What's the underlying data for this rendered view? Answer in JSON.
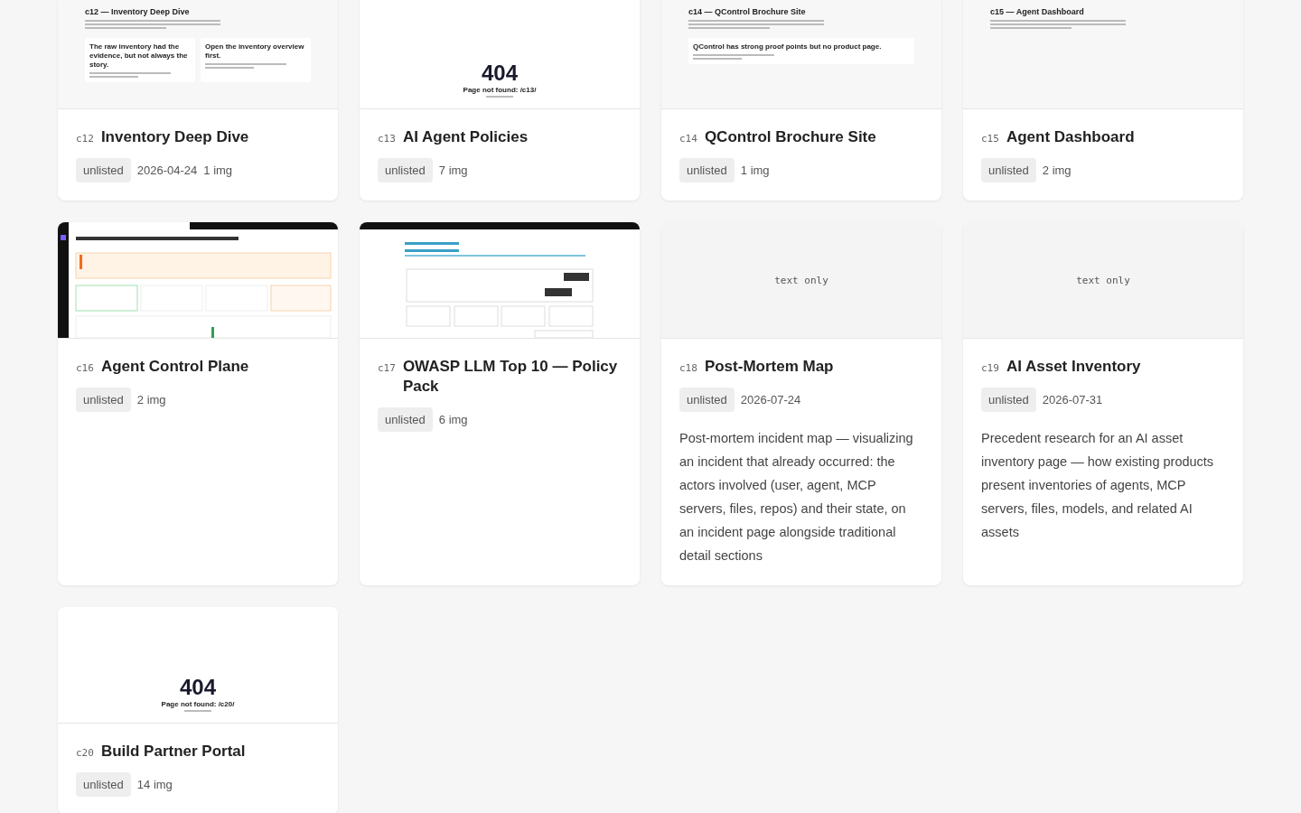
{
  "cards": [
    {
      "id": "c12",
      "title": "Inventory Deep Dive",
      "status": "unlisted",
      "date": "2026-04-24",
      "images": "1 img",
      "thumb": {
        "kind": "doc",
        "heading": "c12 — Inventory Deep Dive",
        "panels": [
          "The raw inventory had the evidence, but not always the story.",
          "Open the inventory overview first."
        ]
      }
    },
    {
      "id": "c13",
      "title": "AI Agent Policies",
      "status": "unlisted",
      "images": "7 img",
      "thumb": {
        "kind": "notfound",
        "code": "404",
        "message": "Page not found: /c13/"
      }
    },
    {
      "id": "c14",
      "title": "QControl Brochure Site",
      "status": "unlisted",
      "images": "1 img",
      "thumb": {
        "kind": "doc",
        "heading": "c14 — QControl Brochure Site",
        "panels": [
          "QControl has strong proof points but no product page."
        ]
      }
    },
    {
      "id": "c15",
      "title": "Agent Dashboard",
      "status": "unlisted",
      "images": "2 img",
      "thumb": {
        "kind": "doc",
        "heading": "c15 — Agent Dashboard"
      }
    },
    {
      "id": "c16",
      "title": "Agent Control Plane",
      "status": "unlisted",
      "images": "2 img",
      "thumb": {
        "kind": "dashboard"
      }
    },
    {
      "id": "c17",
      "title": "OWASP LLM Top 10 — Policy Pack",
      "status": "unlisted",
      "images": "6 img",
      "thumb": {
        "kind": "console"
      }
    },
    {
      "id": "c18",
      "title": "Post-Mortem Map",
      "status": "unlisted",
      "date": "2026-07-24",
      "description": "Post-mortem incident map — visualizing an incident that already occurred: the actors involved (user, agent, MCP servers, files, repos) and their state, on an incident page alongside traditional detail sections",
      "thumb": {
        "kind": "text",
        "label": "text only"
      }
    },
    {
      "id": "c19",
      "title": "AI Asset Inventory",
      "status": "unlisted",
      "date": "2026-07-31",
      "description": "Precedent research for an AI asset inventory page — how existing products present inventories of agents, MCP servers, files, models, and related AI assets",
      "thumb": {
        "kind": "text",
        "label": "text only"
      }
    },
    {
      "id": "c20",
      "title": "Build Partner Portal",
      "status": "unlisted",
      "images": "14 img",
      "thumb": {
        "kind": "notfound",
        "code": "404",
        "message": "Page not found: /c20/"
      }
    }
  ]
}
